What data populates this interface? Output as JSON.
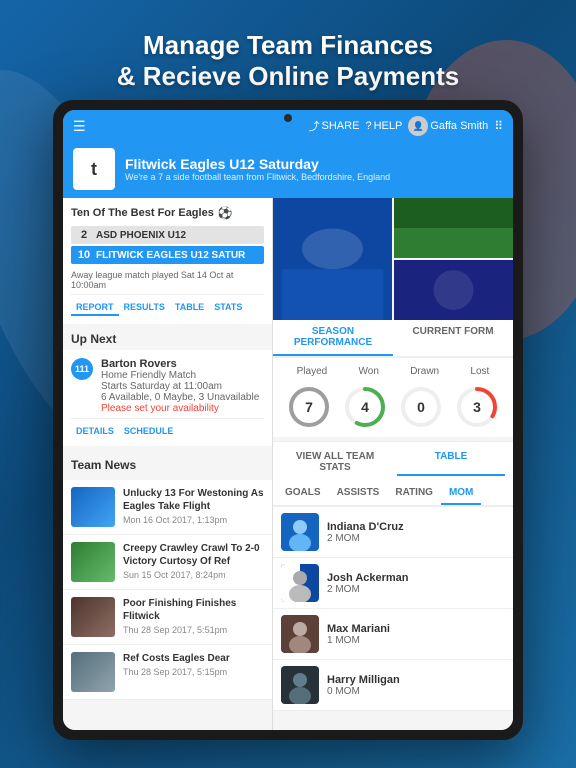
{
  "hero": {
    "line1": "Manage Team Finances",
    "line2": "& Recieve Online Payments"
  },
  "nav": {
    "share": "SHARE",
    "help": "HELP",
    "user": "Gaffa Smith"
  },
  "team": {
    "logo": "t",
    "name": "Flitwick Eagles U12 Saturday",
    "subtitle": "We're a 7 a side football team from Flitwick, Bedfordshire, England"
  },
  "match": {
    "title": "Ten Of The Best For Eagles",
    "away_score": "2",
    "away_name": "ASD PHOENIX U12",
    "home_score": "10",
    "home_name": "FLITWICK EAGLES U12 SATUR",
    "info": "Away league match played Sat 14 Oct at 10:00am",
    "tabs": [
      "REPORT",
      "RESULTS",
      "TABLE",
      "STATS"
    ]
  },
  "upnext": {
    "title": "Up Next",
    "opponent": "Barton Rovers",
    "type": "Home Friendly Match",
    "time": "Starts Saturday at 11:00am",
    "availability": "6 Available, 0 Maybe, 3 Unavailable",
    "avail_cta": "Please set your availability",
    "tabs": [
      "DETAILS",
      "SCHEDULE"
    ],
    "icon_label": "111"
  },
  "news": {
    "title": "Team News",
    "items": [
      {
        "title": "Unlucky 13 For Westoning As Eagles Take Flight",
        "date": "Mon 16 Oct 2017, 1:13pm",
        "thumb_class": "thumb-blue"
      },
      {
        "title": "Creepy Crawley Crawl To 2-0 Victory Curtosy Of Ref",
        "date": "Sun 15 Oct 2017, 8:24pm",
        "thumb_class": "thumb-green"
      },
      {
        "title": "Poor Finishing Finishes Flitwick",
        "date": "Thu 28 Sep 2017, 5:51pm",
        "thumb_class": "thumb-brown"
      },
      {
        "title": "Ref Costs Eagles Dear",
        "date": "Thu 28 Sep 2017, 5:15pm",
        "thumb_class": "thumb-gray"
      }
    ]
  },
  "season_perf": {
    "tab1": "SEASON PERFORMANCE",
    "tab2": "CURRENT FORM",
    "labels": [
      "Played",
      "Won",
      "Drawn",
      "Lost"
    ],
    "values": [
      7,
      4,
      0,
      3
    ],
    "view_btn1": "VIEW ALL TEAM STATS",
    "view_btn2": "TABLE"
  },
  "mom": {
    "tabs": [
      "GOALS",
      "ASSISTS",
      "RATING",
      "MOM"
    ],
    "players": [
      {
        "name": "Indiana D'Cruz",
        "stat": "2 MOM",
        "avatar": "pa-blue"
      },
      {
        "name": "Josh Ackerman",
        "stat": "2 MOM",
        "avatar": "pa-striped"
      },
      {
        "name": "Max Mariani",
        "stat": "1 MOM",
        "avatar": "pa-brown"
      },
      {
        "name": "Harry Milligan",
        "stat": "0 MOM",
        "avatar": "pa-dark"
      }
    ]
  },
  "colors": {
    "primary": "#2196F3",
    "red": "#f44336",
    "gray": "#666666"
  }
}
